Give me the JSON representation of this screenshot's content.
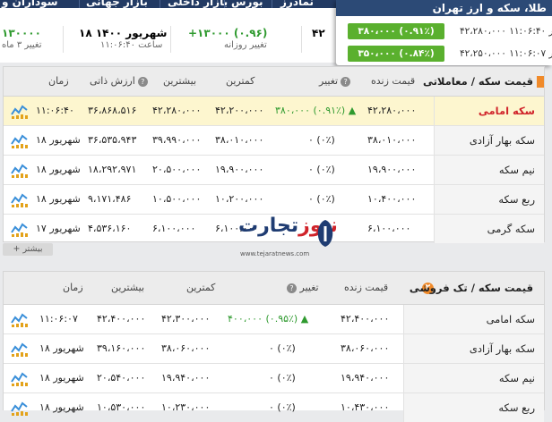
{
  "nav": {
    "items": [
      "سوداران و",
      "بازار جهانی",
      "بازار داخلی",
      "بورس",
      "نمادرز"
    ]
  },
  "strip": {
    "col1": {
      "value": "۱۳۰۰۰۰",
      "label": "تغییر ۳ ماه"
    },
    "col2": {
      "value": "۱۸ شهریور ۱۴۰۰",
      "label": "ساعت ۱۱:۰۶:۴۰"
    },
    "col3": {
      "value": "+۱۳۰۰۰ (۰.۹۶)",
      "label": "تغییر روزانه"
    },
    "col4": {
      "value": "۴۲"
    }
  },
  "popup": {
    "title": "طلا، سکه و ارز تهران",
    "rows": [
      {
        "price": "۴۲،۲۸۰،۰۰۰",
        "time": "در ۱۱:۰۶:۴۰",
        "change": "۳۸۰،۰۰۰ (۰.۹۱٪)"
      },
      {
        "price": "۴۲،۲۵۰،۰۰۰",
        "time": "در ۱۱:۰۶:۰۷",
        "change": "۳۵۰،۰۰۰ (۰.۸۴٪)"
      }
    ]
  },
  "panel1": {
    "title": "قیمت سکه / معاملاتی",
    "headers": {
      "live": "قیمت زنده",
      "change": "تغییر",
      "min": "کمترین",
      "max": "بیشترین",
      "intrinsic": "ارزش ذاتی",
      "time": "زمان"
    },
    "rows": [
      {
        "name": "سکه امامی",
        "price": "۴۲،۲۸۰،۰۰۰",
        "change": "۳۸۰،۰۰۰ (۰.۹۱٪)",
        "arrow": "▲",
        "min": "۴۲،۲۰۰،۰۰۰",
        "max": "۴۲،۲۸۰،۰۰۰",
        "intrinsic": "۳۶،۸۶۸،۵۱۶",
        "time": "۱۱:۰۶:۴۰"
      },
      {
        "name": "سکه بهار آزادی",
        "price": "۳۸،۰۱۰،۰۰۰",
        "change": "۰ (۰٪)",
        "arrow": "",
        "min": "۳۸،۰۱۰،۰۰۰",
        "max": "۳۹،۹۹۰،۰۰۰",
        "intrinsic": "۳۶،۵۳۵،۹۴۳",
        "time": "۱۸ شهریور"
      },
      {
        "name": "نیم سکه",
        "price": "۱۹،۹۰۰،۰۰۰",
        "change": "۰ (۰٪)",
        "arrow": "",
        "min": "۱۹،۹۰۰،۰۰۰",
        "max": "۲۰،۵۰۰،۰۰۰",
        "intrinsic": "۱۸،۲۹۲،۹۷۱",
        "time": "۱۸ شهریور"
      },
      {
        "name": "ربع سکه",
        "price": "۱۰،۴۰۰،۰۰۰",
        "change": "۰ (۰٪)",
        "arrow": "",
        "min": "۱۰،۲۰۰،۰۰۰",
        "max": "۱۰،۵۰۰،۰۰۰",
        "intrinsic": "۹،۱۷۱،۴۸۶",
        "time": "۱۸ شهریور"
      },
      {
        "name": "سکه گرمی",
        "price": "۶،۱۰۰،۰۰۰",
        "change": "",
        "arrow": "",
        "min": "۶،۱۰۰،۰۰۰",
        "max": "۶،۱۰۰،۰۰۰",
        "intrinsic": "۴،۵۳۶،۱۶۰",
        "time": "۱۷ شهریور"
      }
    ],
    "more_label": "+ بیشتر"
  },
  "panel2": {
    "badge": "۲",
    "title": "قیمت سکه / تک فروشی",
    "headers": {
      "live": "قیمت زنده",
      "change": "تغییر",
      "min": "کمترین",
      "max": "بیشترین",
      "time": "زمان"
    },
    "rows": [
      {
        "name": "سکه امامی",
        "price": "۴۲،۴۰۰،۰۰۰",
        "change": "۴۰۰،۰۰۰ (۰.۹۵٪)",
        "arrow": "▲",
        "min": "۴۲،۳۰۰،۰۰۰",
        "max": "۴۲،۴۰۰،۰۰۰",
        "time": "۱۱:۰۶:۰۷"
      },
      {
        "name": "سکه بهار آزادی",
        "price": "۳۸،۰۶۰،۰۰۰",
        "change": "۰ (۰٪)",
        "arrow": "",
        "min": "۳۸،۰۶۰،۰۰۰",
        "max": "۳۹،۱۶۰،۰۰۰",
        "time": "۱۸ شهریور"
      },
      {
        "name": "نیم سکه",
        "price": "۱۹،۹۴۰،۰۰۰",
        "change": "۰ (۰٪)",
        "arrow": "",
        "min": "۱۹،۹۴۰،۰۰۰",
        "max": "۲۰،۵۴۰،۰۰۰",
        "time": "۱۸ شهریور"
      },
      {
        "name": "ربع سکه",
        "price": "۱۰،۴۳۰،۰۰۰",
        "change": "۰ (۰٪)",
        "arrow": "",
        "min": "۱۰،۲۳۰،۰۰۰",
        "max": "۱۰،۵۳۰،۰۰۰",
        "time": "۱۸ شهریور"
      }
    ]
  },
  "logo": {
    "text_main": "تجارت",
    "text_accent": "نیوز",
    "url": "www.tejaratnews.com"
  },
  "colors": {
    "nav": "#223a63",
    "accent_green": "#5ab02e",
    "accent_red": "#d0232a",
    "highlight": "#fdf6cf",
    "badge_orange": "#f08a2a"
  }
}
